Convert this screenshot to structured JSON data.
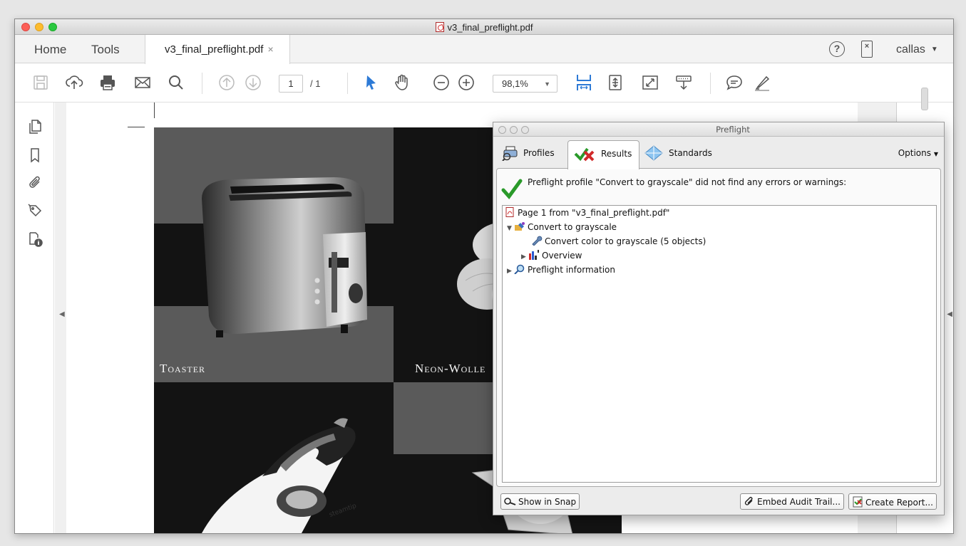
{
  "window": {
    "title": "v3_final_preflight.pdf"
  },
  "tabbar": {
    "home": "Home",
    "tools": "Tools",
    "doc_tab": "v3_final_preflight.pdf",
    "doc_tab_close": "×",
    "help": "?",
    "user": "callas"
  },
  "toolbar": {
    "page_current": "1",
    "page_total": "/ 1",
    "zoom": "98,1%"
  },
  "document": {
    "captions": [
      "Toaster",
      "Neon-Wolle"
    ],
    "iron_brand": "steamtip"
  },
  "preflight": {
    "title": "Preflight",
    "tabs": [
      "Profiles",
      "Results",
      "Standards"
    ],
    "selected_tab": "Results",
    "options": "Options",
    "message": "Preflight profile \"Convert to grayscale\" did not find any errors or warnings:",
    "tree": [
      {
        "label": "Page 1 from \"v3_final_preflight.pdf\"",
        "icon": "pdf-icon"
      },
      {
        "label": "Convert to grayscale",
        "icon": "fixup-icon"
      },
      {
        "label": "Convert color to grayscale (5 objects)",
        "icon": "wrench-icon"
      },
      {
        "label": "Overview",
        "icon": "chart-icon"
      },
      {
        "label": "Preflight information",
        "icon": "magnifier-icon"
      }
    ],
    "buttons": {
      "show_in_snap": "Show in Snap",
      "embed_audit": "Embed Audit Trail...",
      "create_report": "Create Report..."
    }
  }
}
